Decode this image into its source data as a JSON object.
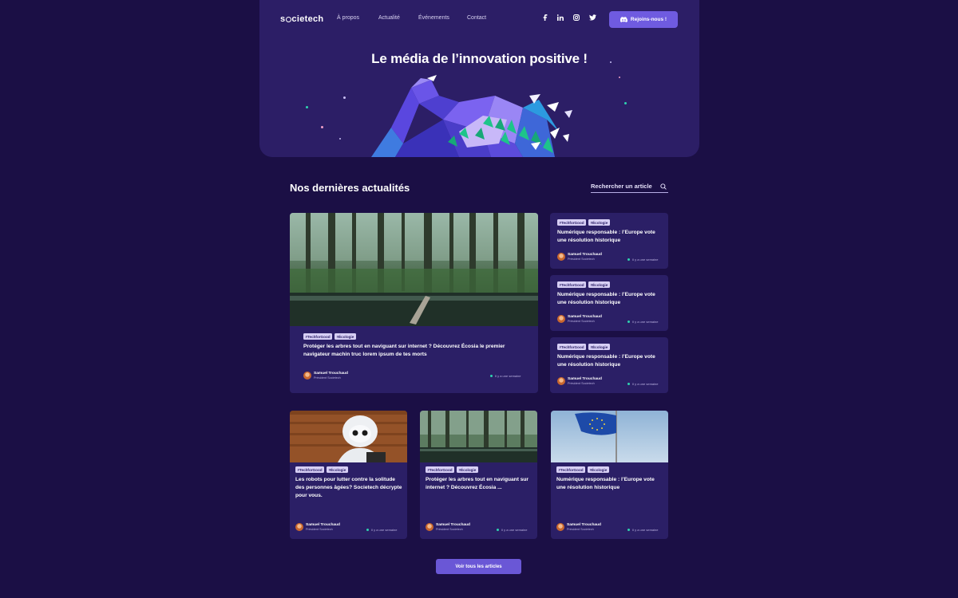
{
  "brand": {
    "logo": "societech"
  },
  "nav": {
    "items": [
      "À propos",
      "Actualité",
      "Événements",
      "Contact"
    ]
  },
  "social": [
    "facebook-icon",
    "linkedin-icon",
    "instagram-icon",
    "twitter-icon"
  ],
  "join_button": {
    "label": "Rejoins-nous !"
  },
  "hero": {
    "title": "Le média de l’innovation positive !"
  },
  "news": {
    "title": "Nos dernières actualités",
    "search_placeholder": "Rechercher un article"
  },
  "featured": {
    "tags": [
      "#TechforGood",
      "#Écologie"
    ],
    "title": "Protéger les arbres tout en naviguant sur internet ? Découvrez Écosia le premier navigateur machin truc lorem ipsum de tes morts",
    "author": "Samuel Trouchaud",
    "role": "Président Societech",
    "time": "Il y a une semaine"
  },
  "side_cards": [
    {
      "tags": [
        "#TechforGood",
        "#Écologie"
      ],
      "title": "Numérique responsable : l’Europe vote une résolution historique",
      "author": "Samuel Trouchaud",
      "role": "Président Societech",
      "time": "Il y a une semaine"
    },
    {
      "tags": [
        "#TechforGood",
        "#Écologie"
      ],
      "title": "Numérique responsable : l’Europe vote une résolution historique",
      "author": "Samuel Trouchaud",
      "role": "Président Societech",
      "time": "Il y a une semaine"
    },
    {
      "tags": [
        "#TechforGood",
        "#Écologie"
      ],
      "title": "Numérique responsable : l’Europe vote une résolution historique",
      "author": "Samuel Trouchaud",
      "role": "Président Societech",
      "time": "Il y a une semaine"
    }
  ],
  "bottom_cards": [
    {
      "tags": [
        "#TechforGood",
        "#Écologie"
      ],
      "title": "Les robots pour lutter contre la solitude des personnes âgées? Societech décrypte pour vous.",
      "author": "Samuel Trouchaud",
      "role": "Président Societech",
      "time": "Il y a une semaine"
    },
    {
      "tags": [
        "#TechforGood",
        "#Écologie"
      ],
      "title": "Protéger les arbres tout en naviguant sur internet ? Découvrez Écosia ...",
      "author": "Samuel Trouchaud",
      "role": "Président Societech",
      "time": "Il y a une semaine"
    },
    {
      "tags": [
        "#TechforGood",
        "#Écologie"
      ],
      "title": "Numérique responsable : l’Europe vote une résolution historique",
      "author": "Samuel Trouchaud",
      "role": "Président Societech",
      "time": "Il y a une semaine"
    }
  ],
  "see_all": {
    "label": "Voir tous les articles"
  },
  "colors": {
    "background": "#1b0f45",
    "hero": "#2c1e66",
    "card": "#2b1f66",
    "accent": "#6f5be0",
    "tag": "#d7cff5",
    "status_dot": "#2fd3b0"
  }
}
